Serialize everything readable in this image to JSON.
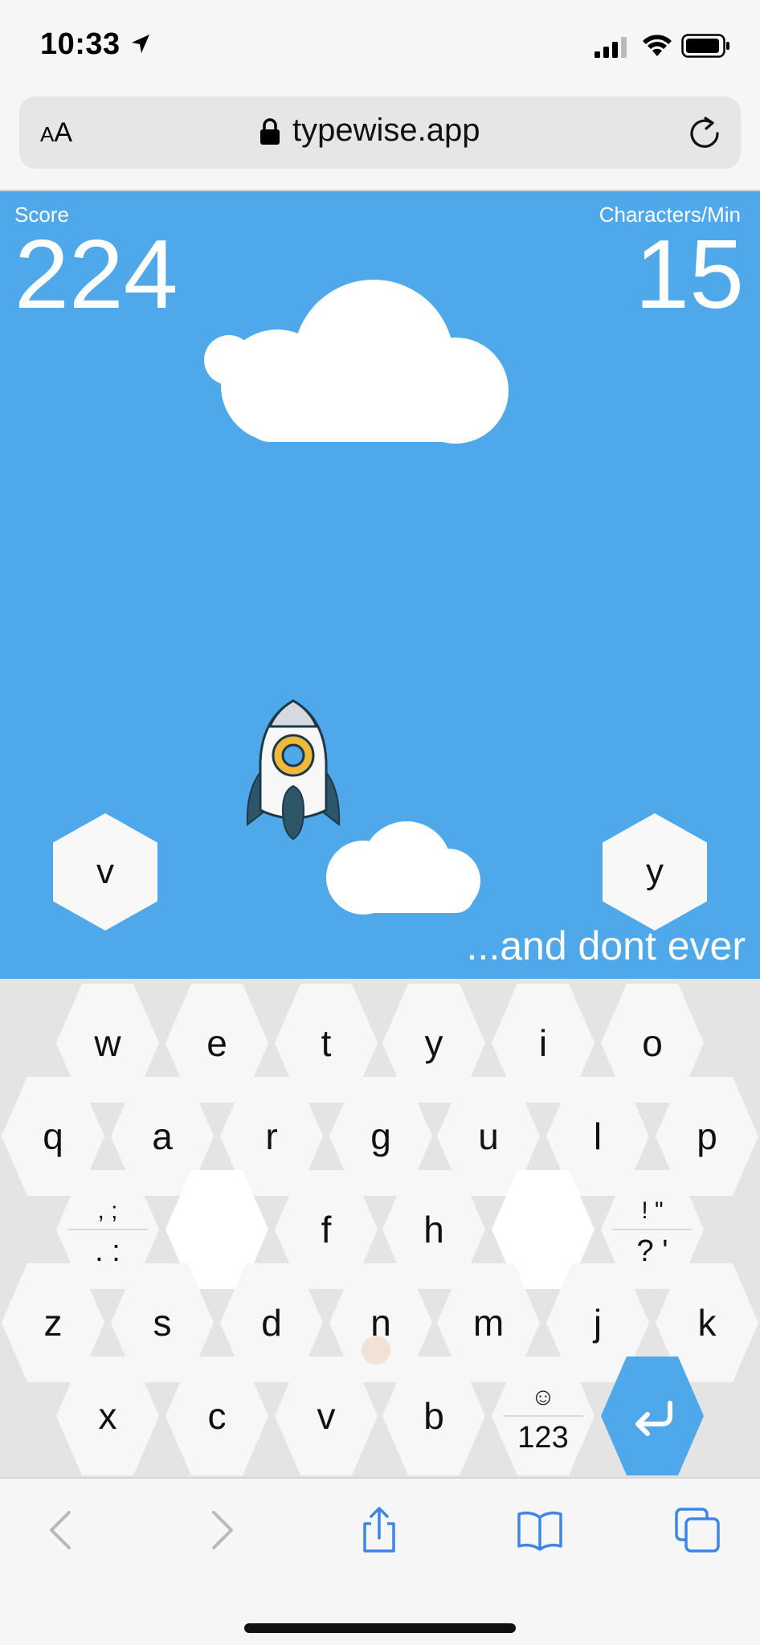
{
  "status_bar": {
    "time": "10:33"
  },
  "browser": {
    "text_size_button": {
      "small": "A",
      "large": "A"
    },
    "url": "typewise.app"
  },
  "game": {
    "score_label": "Score",
    "score_value": "224",
    "cpm_label": "Characters/Min",
    "cpm_value": "15",
    "floating_letters": [
      "v",
      "y"
    ],
    "sentence_visible": "...and dont ever",
    "colors": {
      "sky": "#4fa8ea",
      "cloud": "#ffffff",
      "rocket_window": "#f0b93a",
      "rocket_fins": "#2f5568"
    }
  },
  "keyboard": {
    "row1": [
      "w",
      "e",
      "t",
      "y",
      "i",
      "o"
    ],
    "row2": [
      "q",
      "a",
      "r",
      "g",
      "u",
      "l",
      "p"
    ],
    "row3": {
      "punct_left_top": ", ;",
      "punct_left_bottom": ". :",
      "f": "f",
      "h": "h",
      "punct_right_top": "! \"",
      "punct_right_bottom": "? '"
    },
    "row4": [
      "z",
      "s",
      "d",
      "n",
      "m",
      "j",
      "k"
    ],
    "row5": [
      "x",
      "c",
      "v",
      "b"
    ],
    "emoji_glyph": "☺",
    "numbers_key": "123",
    "enter_icon": "return-arrow-icon",
    "accent_color": "#4fa8ea"
  },
  "toolbar": {
    "icons": [
      "back-icon",
      "forward-icon",
      "share-icon",
      "bookmarks-icon",
      "tabs-icon"
    ]
  }
}
